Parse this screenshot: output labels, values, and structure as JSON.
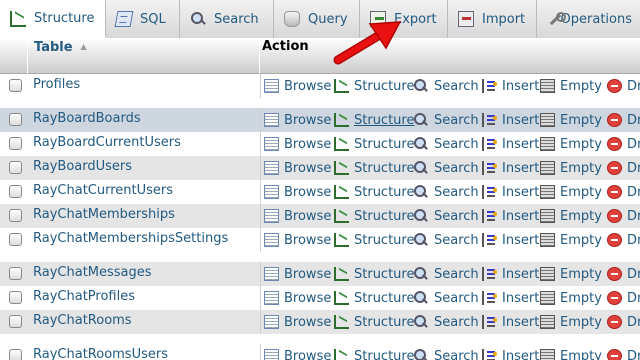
{
  "tabs": [
    {
      "label": "Structure",
      "icon": "structure-icon",
      "active": true
    },
    {
      "label": "SQL",
      "icon": "sql-icon"
    },
    {
      "label": "Search",
      "icon": "search-icon"
    },
    {
      "label": "Query",
      "icon": "query-icon"
    },
    {
      "label": "Export",
      "icon": "export-icon"
    },
    {
      "label": "Import",
      "icon": "import-icon"
    },
    {
      "label": "Operations",
      "icon": "operations-icon"
    }
  ],
  "table_header": {
    "table_label": "Table",
    "sort_glyph": "▲",
    "action_label": "Action"
  },
  "actions": {
    "browse": "Browse",
    "structure": "Structure",
    "search": "Search",
    "insert": "Insert",
    "empty": "Empty",
    "drop": "Dr"
  },
  "rows": [
    {
      "name": "Profiles"
    },
    {
      "name": "RayBoardBoards"
    },
    {
      "name": "RayBoardCurrentUsers"
    },
    {
      "name": "RayBoardUsers"
    },
    {
      "name": "RayChatCurrentUsers"
    },
    {
      "name": "RayChatMemberships"
    },
    {
      "name": "RayChatMembershipsSettings"
    },
    {
      "name": "RayChatMessages"
    },
    {
      "name": "RayChatProfiles"
    },
    {
      "name": "RayChatRooms"
    },
    {
      "name": "RayChatRoomsUsers"
    }
  ],
  "colors": {
    "link": "#235a81",
    "arrow": "#e00000",
    "highlight_row": "#ced6df"
  }
}
